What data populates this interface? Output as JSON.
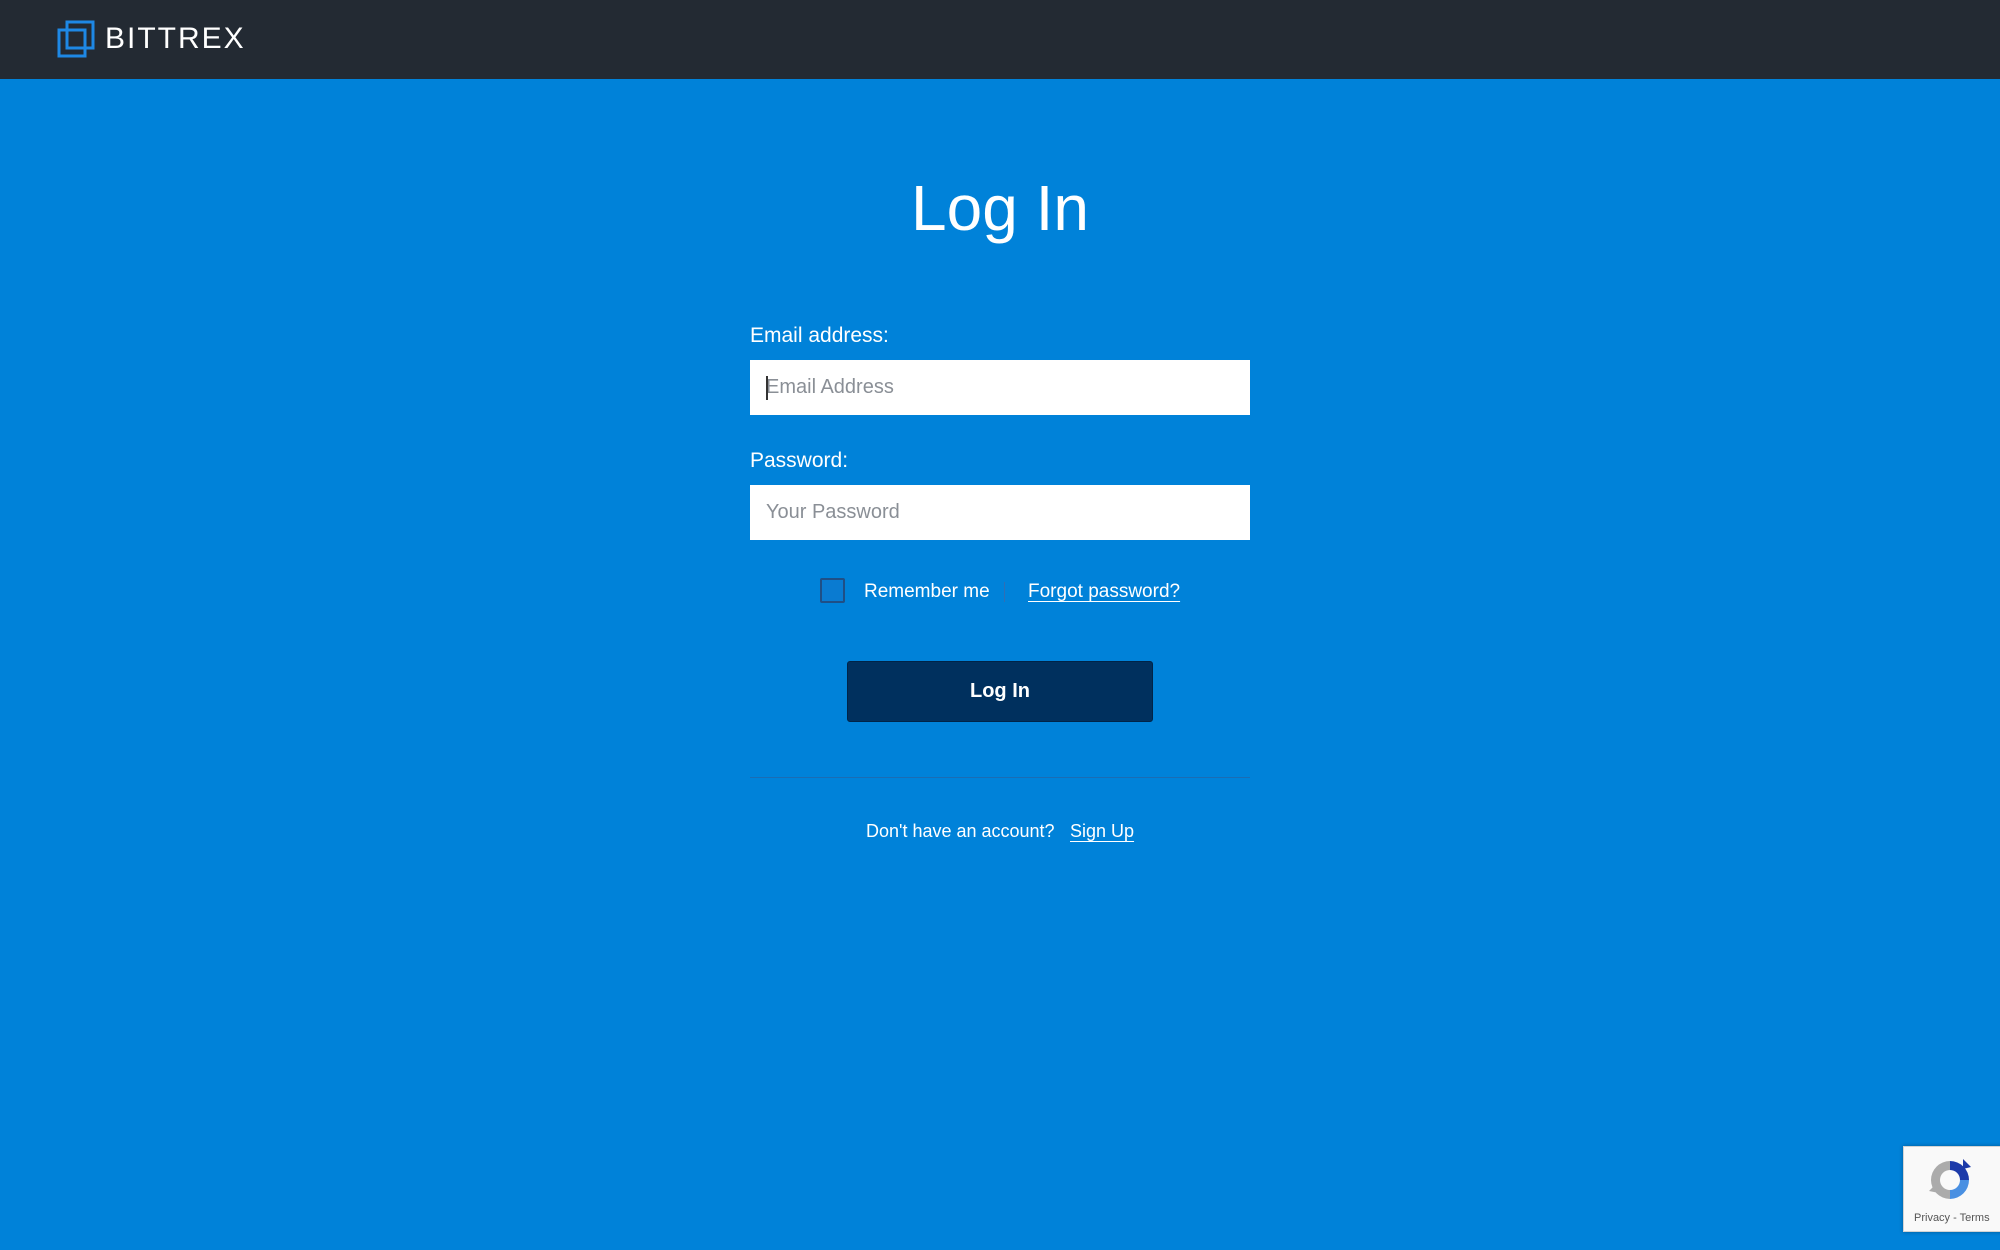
{
  "header": {
    "brand_name": "BITTREX",
    "logo_icon": "bittrex-logo-icon"
  },
  "login": {
    "title": "Log In",
    "email_label": "Email address:",
    "email_placeholder": "Email Address",
    "email_value": "",
    "password_label": "Password:",
    "password_placeholder": "Your Password",
    "password_value": "",
    "remember_label": "Remember me",
    "remember_checked": false,
    "forgot_link": "Forgot password?",
    "submit_label": "Log In",
    "signup_prompt": "Don't have an account?",
    "signup_link": "Sign Up"
  },
  "recaptcha": {
    "icon": "recaptcha-icon",
    "privacy_link": "Privacy",
    "separator": " - ",
    "terms_link": "Terms"
  },
  "colors": {
    "header_bg": "#232A33",
    "page_bg": "#0082D9",
    "button_bg": "#00305E",
    "logo_accent": "#1E88E5",
    "text": "#FFFFFF"
  }
}
